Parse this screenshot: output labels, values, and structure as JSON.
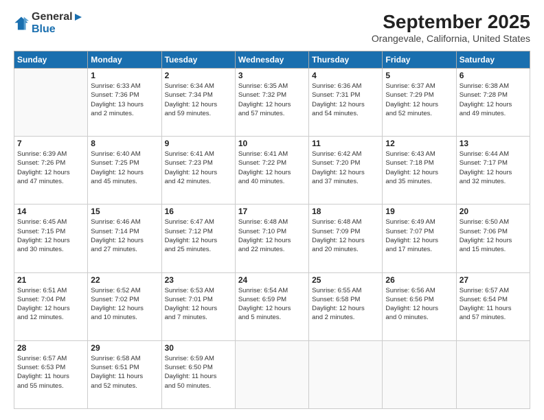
{
  "logo": {
    "general": "General",
    "blue": "Blue"
  },
  "title": "September 2025",
  "subtitle": "Orangevale, California, United States",
  "days_header": [
    "Sunday",
    "Monday",
    "Tuesday",
    "Wednesday",
    "Thursday",
    "Friday",
    "Saturday"
  ],
  "weeks": [
    [
      {
        "day": "",
        "info": ""
      },
      {
        "day": "1",
        "info": "Sunrise: 6:33 AM\nSunset: 7:36 PM\nDaylight: 13 hours\nand 2 minutes."
      },
      {
        "day": "2",
        "info": "Sunrise: 6:34 AM\nSunset: 7:34 PM\nDaylight: 12 hours\nand 59 minutes."
      },
      {
        "day": "3",
        "info": "Sunrise: 6:35 AM\nSunset: 7:32 PM\nDaylight: 12 hours\nand 57 minutes."
      },
      {
        "day": "4",
        "info": "Sunrise: 6:36 AM\nSunset: 7:31 PM\nDaylight: 12 hours\nand 54 minutes."
      },
      {
        "day": "5",
        "info": "Sunrise: 6:37 AM\nSunset: 7:29 PM\nDaylight: 12 hours\nand 52 minutes."
      },
      {
        "day": "6",
        "info": "Sunrise: 6:38 AM\nSunset: 7:28 PM\nDaylight: 12 hours\nand 49 minutes."
      }
    ],
    [
      {
        "day": "7",
        "info": "Sunrise: 6:39 AM\nSunset: 7:26 PM\nDaylight: 12 hours\nand 47 minutes."
      },
      {
        "day": "8",
        "info": "Sunrise: 6:40 AM\nSunset: 7:25 PM\nDaylight: 12 hours\nand 45 minutes."
      },
      {
        "day": "9",
        "info": "Sunrise: 6:41 AM\nSunset: 7:23 PM\nDaylight: 12 hours\nand 42 minutes."
      },
      {
        "day": "10",
        "info": "Sunrise: 6:41 AM\nSunset: 7:22 PM\nDaylight: 12 hours\nand 40 minutes."
      },
      {
        "day": "11",
        "info": "Sunrise: 6:42 AM\nSunset: 7:20 PM\nDaylight: 12 hours\nand 37 minutes."
      },
      {
        "day": "12",
        "info": "Sunrise: 6:43 AM\nSunset: 7:18 PM\nDaylight: 12 hours\nand 35 minutes."
      },
      {
        "day": "13",
        "info": "Sunrise: 6:44 AM\nSunset: 7:17 PM\nDaylight: 12 hours\nand 32 minutes."
      }
    ],
    [
      {
        "day": "14",
        "info": "Sunrise: 6:45 AM\nSunset: 7:15 PM\nDaylight: 12 hours\nand 30 minutes."
      },
      {
        "day": "15",
        "info": "Sunrise: 6:46 AM\nSunset: 7:14 PM\nDaylight: 12 hours\nand 27 minutes."
      },
      {
        "day": "16",
        "info": "Sunrise: 6:47 AM\nSunset: 7:12 PM\nDaylight: 12 hours\nand 25 minutes."
      },
      {
        "day": "17",
        "info": "Sunrise: 6:48 AM\nSunset: 7:10 PM\nDaylight: 12 hours\nand 22 minutes."
      },
      {
        "day": "18",
        "info": "Sunrise: 6:48 AM\nSunset: 7:09 PM\nDaylight: 12 hours\nand 20 minutes."
      },
      {
        "day": "19",
        "info": "Sunrise: 6:49 AM\nSunset: 7:07 PM\nDaylight: 12 hours\nand 17 minutes."
      },
      {
        "day": "20",
        "info": "Sunrise: 6:50 AM\nSunset: 7:06 PM\nDaylight: 12 hours\nand 15 minutes."
      }
    ],
    [
      {
        "day": "21",
        "info": "Sunrise: 6:51 AM\nSunset: 7:04 PM\nDaylight: 12 hours\nand 12 minutes."
      },
      {
        "day": "22",
        "info": "Sunrise: 6:52 AM\nSunset: 7:02 PM\nDaylight: 12 hours\nand 10 minutes."
      },
      {
        "day": "23",
        "info": "Sunrise: 6:53 AM\nSunset: 7:01 PM\nDaylight: 12 hours\nand 7 minutes."
      },
      {
        "day": "24",
        "info": "Sunrise: 6:54 AM\nSunset: 6:59 PM\nDaylight: 12 hours\nand 5 minutes."
      },
      {
        "day": "25",
        "info": "Sunrise: 6:55 AM\nSunset: 6:58 PM\nDaylight: 12 hours\nand 2 minutes."
      },
      {
        "day": "26",
        "info": "Sunrise: 6:56 AM\nSunset: 6:56 PM\nDaylight: 12 hours\nand 0 minutes."
      },
      {
        "day": "27",
        "info": "Sunrise: 6:57 AM\nSunset: 6:54 PM\nDaylight: 11 hours\nand 57 minutes."
      }
    ],
    [
      {
        "day": "28",
        "info": "Sunrise: 6:57 AM\nSunset: 6:53 PM\nDaylight: 11 hours\nand 55 minutes."
      },
      {
        "day": "29",
        "info": "Sunrise: 6:58 AM\nSunset: 6:51 PM\nDaylight: 11 hours\nand 52 minutes."
      },
      {
        "day": "30",
        "info": "Sunrise: 6:59 AM\nSunset: 6:50 PM\nDaylight: 11 hours\nand 50 minutes."
      },
      {
        "day": "",
        "info": ""
      },
      {
        "day": "",
        "info": ""
      },
      {
        "day": "",
        "info": ""
      },
      {
        "day": "",
        "info": ""
      }
    ]
  ]
}
